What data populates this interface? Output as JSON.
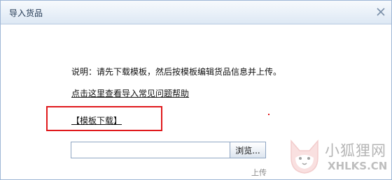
{
  "dialog": {
    "title": "导入货品",
    "close_icon": "close-icon"
  },
  "body": {
    "description": "说明：请先下载模板，然后按模板编辑货品信息并上传。",
    "help_link": "点击这里查看导入常见问题帮助",
    "template_link": "【模板下载】",
    "file_input_value": "",
    "browse_label": "浏览...",
    "upload_label": "上传"
  },
  "watermark": {
    "text_cn": "小狐狸网",
    "text_en": "XHLKS.CN",
    "logo_icon": "fox-logo-icon"
  },
  "colors": {
    "highlight_border": "#e0191c",
    "titlebar": "#dde8f4",
    "border": "#9fb7d6"
  }
}
